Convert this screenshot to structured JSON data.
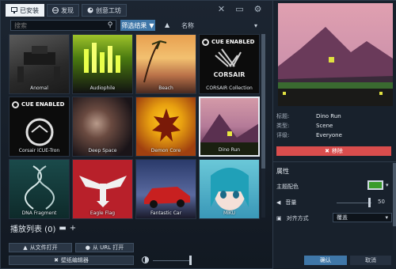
{
  "tabs": [
    {
      "label": "已安装",
      "icon": "monitor-icon"
    },
    {
      "label": "发现",
      "icon": "globe-icon"
    },
    {
      "label": "创意工坊",
      "icon": "steam-icon"
    }
  ],
  "top_icons": [
    "tools-icon",
    "display-icon",
    "settings-icon"
  ],
  "search": {
    "placeholder": "搜索"
  },
  "filter_label": "筛选结果",
  "sort_label": "名称",
  "items": [
    {
      "name": "Anomal",
      "badge": ""
    },
    {
      "name": "Audiophile",
      "badge": ""
    },
    {
      "name": "Beach",
      "badge": ""
    },
    {
      "name": "CORSAIR Collection",
      "badge": "CUE ENABLED",
      "logo": "CORSAIR"
    },
    {
      "name": "Corsair iCUE-Tron",
      "badge": "CUE ENABLED"
    },
    {
      "name": "Deep Space",
      "badge": ""
    },
    {
      "name": "Demon Core",
      "badge": ""
    },
    {
      "name": "Dino Run",
      "badge": ""
    },
    {
      "name": "DNA Fragment",
      "badge": ""
    },
    {
      "name": "Eagle Flag",
      "badge": ""
    },
    {
      "name": "Fantastic Car",
      "badge": ""
    },
    {
      "name": "MIKU",
      "badge": ""
    }
  ],
  "playlist": {
    "label": "播放列表 (0)"
  },
  "buttons": {
    "open_file": "从文件打开",
    "open_url": "从 URL 打开",
    "editor": "壁纸编辑器"
  },
  "details": {
    "title_key": "标题:",
    "title_val": "Dino Run",
    "type_key": "类型:",
    "type_val": "Scene",
    "rating_key": "评级:",
    "rating_val": "Everyone",
    "remove": "移除"
  },
  "properties": {
    "title": "属性",
    "scheme_label": "主题配色",
    "scheme_color": "#3a9b2a",
    "volume_label": "音量",
    "volume_value": "50",
    "align_label": "对齐方式",
    "align_value": "覆盖"
  },
  "footer": {
    "ok": "确认",
    "cancel": "取消"
  }
}
